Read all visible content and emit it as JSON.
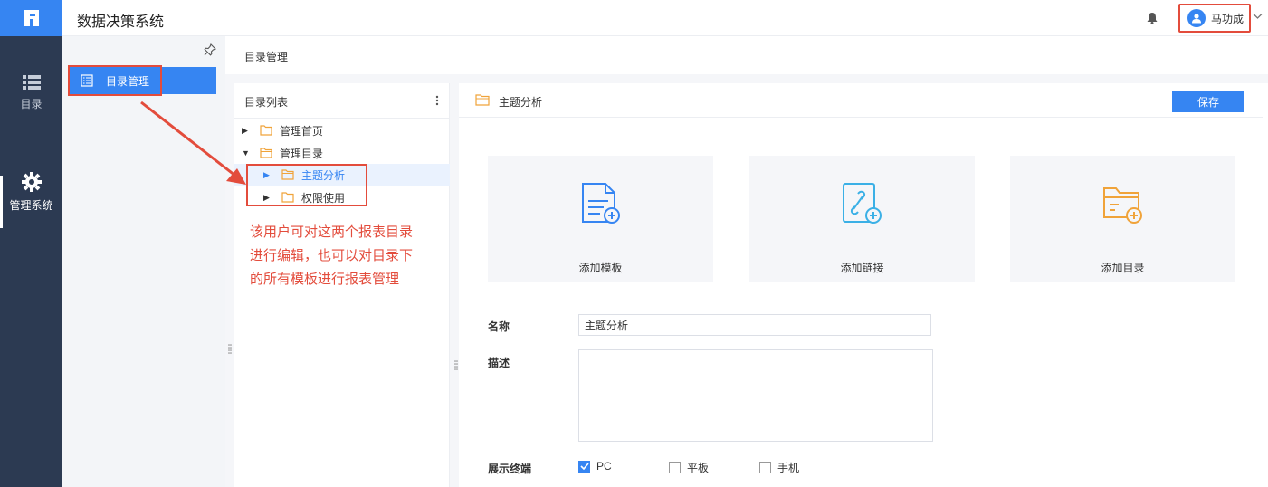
{
  "app": {
    "title": "数据决策系统"
  },
  "rail": {
    "items": [
      {
        "label": "目录"
      },
      {
        "label": "管理系统"
      }
    ]
  },
  "user": {
    "name": "马功成"
  },
  "menu": {
    "item": "目录管理"
  },
  "breadcrumb": "目录管理",
  "tree": {
    "title": "目录列表",
    "nodes": [
      {
        "label": "管理首页",
        "expanded": false,
        "level": 0
      },
      {
        "label": "管理目录",
        "expanded": true,
        "level": 0
      },
      {
        "label": "主题分析",
        "expanded": false,
        "level": 1,
        "selected": true
      },
      {
        "label": "权限使用",
        "expanded": false,
        "level": 1
      }
    ]
  },
  "annotation": [
    "该用户可对这两个报表目录",
    "进行编辑，也可以对目录下",
    "的所有模板进行报表管理"
  ],
  "panel": {
    "title": "主题分析",
    "save": "保存",
    "cards": [
      {
        "label": "添加模板"
      },
      {
        "label": "添加链接"
      },
      {
        "label": "添加目录"
      }
    ],
    "form": {
      "name_label": "名称",
      "name_value": "主题分析",
      "desc_label": "描述",
      "terminal_label": "展示终端",
      "terminals": [
        {
          "label": "PC",
          "checked": true
        },
        {
          "label": "平板",
          "checked": false
        },
        {
          "label": "手机",
          "checked": false
        }
      ]
    }
  },
  "colors": {
    "primary": "#3685f2",
    "rail": "#2c3a52",
    "highlight": "#e34c3c",
    "folder": "#f0a33a"
  }
}
